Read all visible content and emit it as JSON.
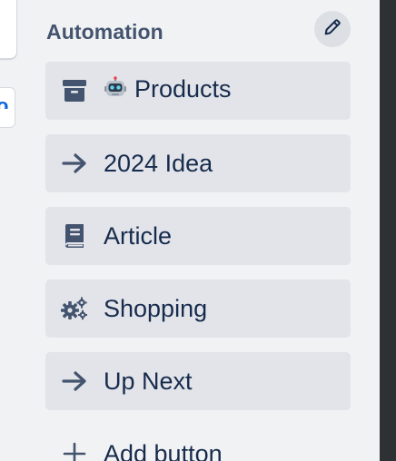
{
  "header": {
    "title": "Automation"
  },
  "edit_button": {
    "icon": "pencil-icon"
  },
  "buttons": [
    {
      "label": "Products",
      "icon": "archive-icon",
      "emoji": "robot-emoji"
    },
    {
      "label": "2024 Idea",
      "icon": "arrow-right-icon"
    },
    {
      "label": "Article",
      "icon": "book-icon"
    },
    {
      "label": "Shopping",
      "icon": "gears-icon"
    },
    {
      "label": "Up Next",
      "icon": "arrow-right-icon"
    }
  ],
  "add_button": {
    "label": "Add button",
    "icon": "plus-icon"
  },
  "colors": {
    "panel_bg": "#f1f2f4",
    "button_bg": "#e2e4e9",
    "text": "#172b4d",
    "heading": "#44546f",
    "icon": "#44546f"
  }
}
